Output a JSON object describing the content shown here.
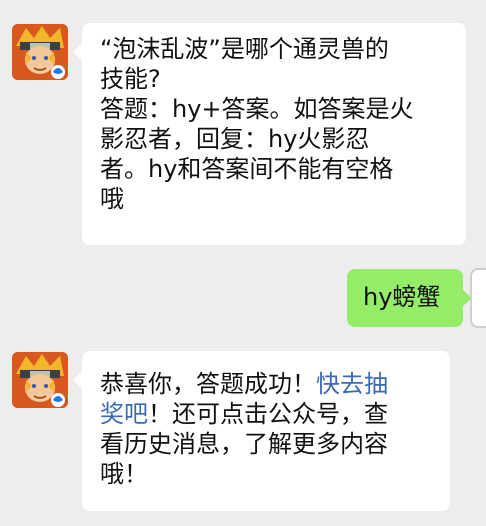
{
  "chat": {
    "messages": [
      {
        "side": "left",
        "sender": "naruto-bot",
        "lines": [
          "“泡沫乱波”是哪个通灵兽的",
          "技能?",
          "答题：hy+答案。如答案是火",
          "影忍者，回复：hy火影忍",
          "者。hy和答案间不能有空格",
          "哦"
        ]
      },
      {
        "side": "right",
        "sender": "user",
        "text": "hy螃蟹"
      },
      {
        "side": "left",
        "sender": "naruto-bot",
        "line1_pre": "恭喜你，答题成功！",
        "line1_link": "快去抽",
        "line2_link": "奖吧",
        "line2_post": "！还可点击公众号，查",
        "line3": "看历史消息，了解更多内容",
        "line4": "哦！"
      }
    ]
  },
  "colors": {
    "background": "#ededed",
    "incoming_bubble": "#ffffff",
    "outgoing_bubble": "#95ec69",
    "link": "#3a6ab5",
    "avatar_accent": "#c4471b"
  },
  "icons": {
    "bot_avatar": "naruto-avatar-icon",
    "game_badge": "game-badge-icon"
  }
}
